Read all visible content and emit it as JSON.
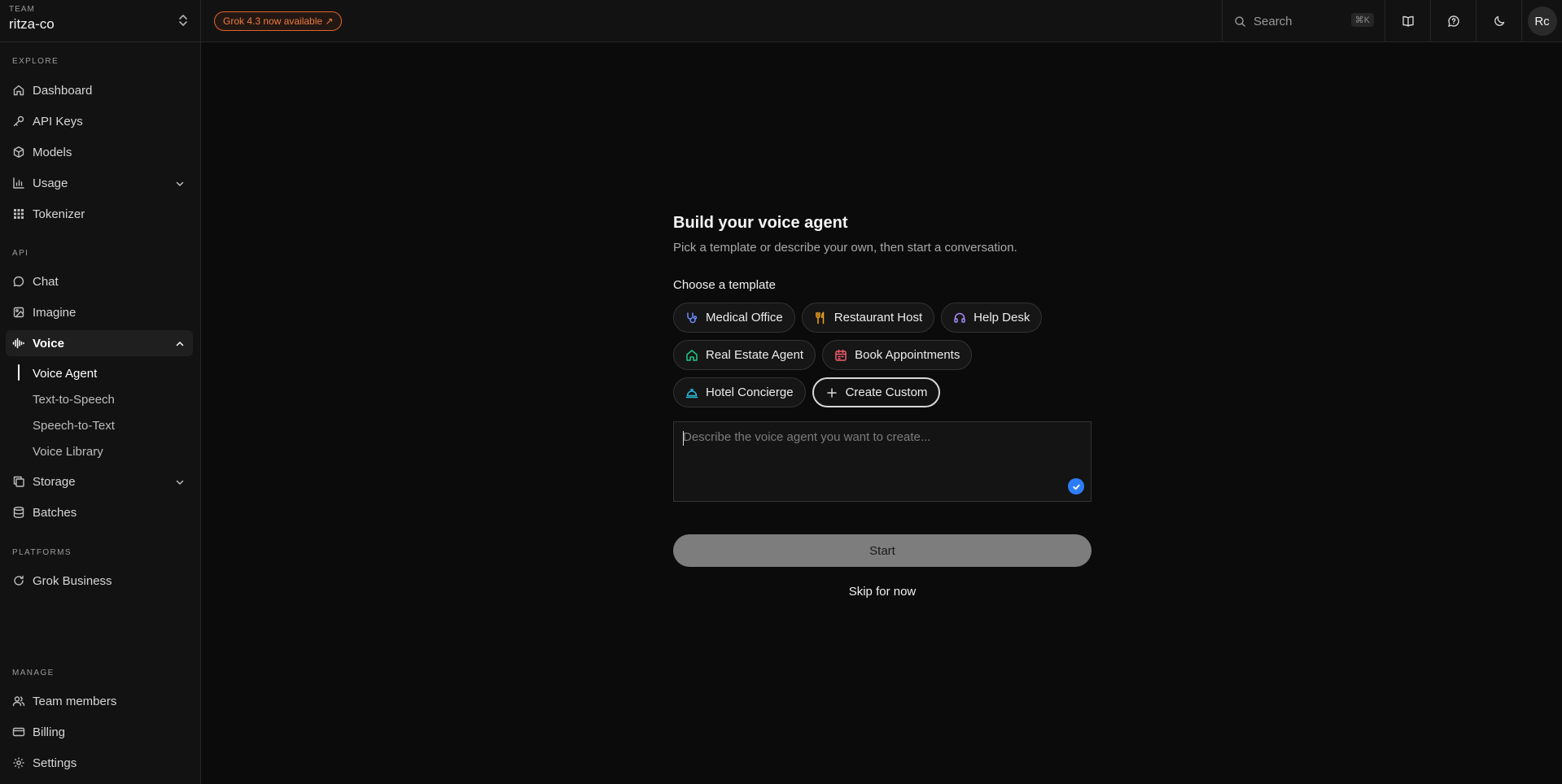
{
  "team": {
    "label": "TEAM",
    "name": "ritza-co"
  },
  "sections": {
    "explore": "EXPLORE",
    "api": "API",
    "platforms": "PLATFORMS",
    "manage": "MANAGE"
  },
  "nav": {
    "dashboard": "Dashboard",
    "api_keys": "API Keys",
    "models": "Models",
    "usage": "Usage",
    "tokenizer": "Tokenizer",
    "chat": "Chat",
    "imagine": "Imagine",
    "voice": "Voice",
    "voice_sub": [
      "Voice Agent",
      "Text-to-Speech",
      "Speech-to-Text",
      "Voice Library"
    ],
    "storage": "Storage",
    "batches": "Batches",
    "grok_business": "Grok Business",
    "team_members": "Team members",
    "billing": "Billing",
    "settings": "Settings"
  },
  "topbar": {
    "announcement": "Grok 4.3 now available ↗",
    "search_label": "Search",
    "search_shortcut": "⌘K",
    "avatar_initials": "Rc"
  },
  "content": {
    "title": "Build your voice agent",
    "subtitle": "Pick a template or describe your own, then start a conversation.",
    "choose_label": "Choose a template",
    "templates": [
      {
        "label": "Medical Office",
        "icon": "stethoscope-icon",
        "color": "#6b8cff"
      },
      {
        "label": "Restaurant Host",
        "icon": "utensils-icon",
        "color": "#f0a020"
      },
      {
        "label": "Help Desk",
        "icon": "headset-icon",
        "color": "#a78bfa"
      },
      {
        "label": "Real Estate Agent",
        "icon": "house-icon",
        "color": "#22c58b"
      },
      {
        "label": "Book Appointments",
        "icon": "calendar-icon",
        "color": "#f25b6b"
      },
      {
        "label": "Hotel Concierge",
        "icon": "concierge-bell-icon",
        "color": "#2bb6d6"
      }
    ],
    "create_custom": "Create Custom",
    "description_placeholder": "Describe the voice agent you want to create...",
    "start_label": "Start",
    "skip_label": "Skip for now"
  },
  "colors": {
    "accent_orange": "#e2622b",
    "check_blue": "#2d7cf6",
    "background": "#0b0b0b"
  }
}
